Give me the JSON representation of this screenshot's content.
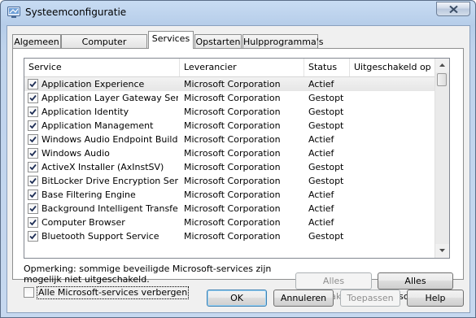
{
  "window": {
    "title": "Systeemconfiguratie"
  },
  "tabs": [
    {
      "label": "Algemeen"
    },
    {
      "label": "Computer opstarten"
    },
    {
      "label": "Services"
    },
    {
      "label": "Opstarten"
    },
    {
      "label": "Hulpprogramma's"
    }
  ],
  "active_tab": "Services",
  "columns": {
    "service": "Service",
    "vendor": "Leverancier",
    "status": "Status",
    "disabled": "Uitgeschakeld op"
  },
  "services": [
    {
      "name": "Application Experience",
      "vendor": "Microsoft Corporation",
      "status": "Actief",
      "disabled": "",
      "checked": true
    },
    {
      "name": "Application Layer Gateway Service",
      "vendor": "Microsoft Corporation",
      "status": "Gestopt",
      "disabled": "",
      "checked": true
    },
    {
      "name": "Application Identity",
      "vendor": "Microsoft Corporation",
      "status": "Gestopt",
      "disabled": "",
      "checked": true
    },
    {
      "name": "Application Management",
      "vendor": "Microsoft Corporation",
      "status": "Gestopt",
      "disabled": "",
      "checked": true
    },
    {
      "name": "Windows Audio Endpoint Builder",
      "vendor": "Microsoft Corporation",
      "status": "Actief",
      "disabled": "",
      "checked": true
    },
    {
      "name": "Windows Audio",
      "vendor": "Microsoft Corporation",
      "status": "Actief",
      "disabled": "",
      "checked": true
    },
    {
      "name": "ActiveX Installer (AxInstSV)",
      "vendor": "Microsoft Corporation",
      "status": "Gestopt",
      "disabled": "",
      "checked": true
    },
    {
      "name": "BitLocker Drive Encryption Service",
      "vendor": "Microsoft Corporation",
      "status": "Gestopt",
      "disabled": "",
      "checked": true
    },
    {
      "name": "Base Filtering Engine",
      "vendor": "Microsoft Corporation",
      "status": "Actief",
      "disabled": "",
      "checked": true
    },
    {
      "name": "Background Intelligent Transfer ...",
      "vendor": "Microsoft Corporation",
      "status": "Actief",
      "disabled": "",
      "checked": true
    },
    {
      "name": "Computer Browser",
      "vendor": "Microsoft Corporation",
      "status": "Actief",
      "disabled": "",
      "checked": true
    },
    {
      "name": "Bluetooth Support Service",
      "vendor": "Microsoft Corporation",
      "status": "Gestopt",
      "disabled": "",
      "checked": true
    }
  ],
  "note": "Opmerking: sommige beveiligde Microsoft-services zijn mogelijk niet uitgeschakeld.",
  "buttons": {
    "enable_all": "Alles inschakelen",
    "disable_all": "Alles uitschakelen",
    "ok": "OK",
    "cancel": "Annuleren",
    "apply": "Toepassen",
    "help": "Help"
  },
  "hide_ms_label": "Alle Microsoft-services verbergen",
  "hide_ms_checked": false,
  "icons": {
    "app": "msconfig-icon",
    "close": "close-icon",
    "check": "checkmark-icon",
    "scroll_up": "scroll-up-arrow-icon",
    "scroll_down": "scroll-down-arrow-icon"
  }
}
